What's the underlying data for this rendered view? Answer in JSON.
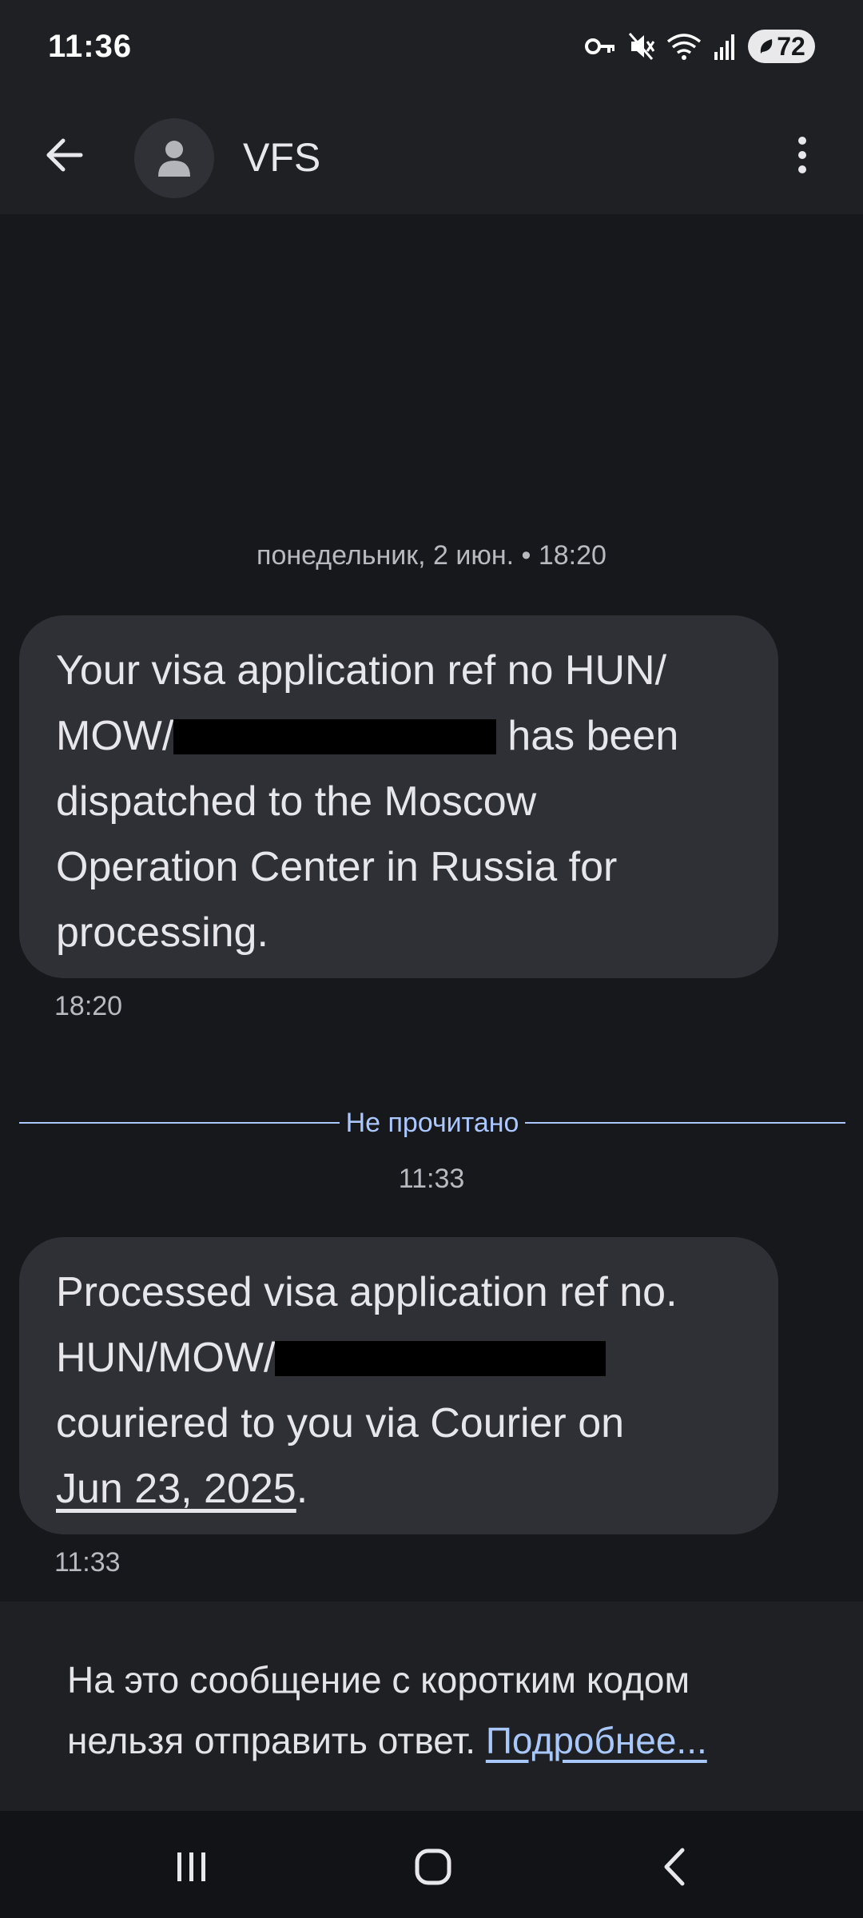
{
  "status_bar": {
    "time": "11:36",
    "battery_level": "72",
    "icons": [
      "vpn-key-icon",
      "mute-icon",
      "wifi-icon",
      "signal-icon",
      "battery-icon"
    ]
  },
  "app_bar": {
    "contact_name": "VFS",
    "icons": [
      "back-arrow-icon",
      "person-avatar-icon",
      "more-vert-icon"
    ]
  },
  "conversation": {
    "date_header": "понедельник, 2 июн. • 18:20",
    "messages": [
      {
        "line1": "Your visa application ref no HUN/",
        "prefix2": "MOW/",
        "suffix2": "has been",
        "line3": "dispatched to the Moscow",
        "line4": "Operation Center in Russia for",
        "line5": "processing.",
        "time": "18:20"
      },
      {
        "line1": "Processed visa application ref no.",
        "prefix2": "HUN/MOW/",
        "line3": "couriered to you via Courier on",
        "date_link": "Jun 23, 2025",
        "date_suffix": ".",
        "time": "11:33"
      }
    ],
    "unread_label": "Не прочитано",
    "unread_time": "11:33"
  },
  "notice": {
    "text": "На это сообщение с коротким кодом нельзя отправить ответ.",
    "link": "Подробнее..."
  },
  "nav_bar": {
    "icons": [
      "recents-icon",
      "home-icon",
      "back-icon"
    ]
  },
  "colors": {
    "background": "#17181c",
    "bubble": "#2f3036",
    "accent": "#aac7ff",
    "link": "#a8c7fa"
  }
}
